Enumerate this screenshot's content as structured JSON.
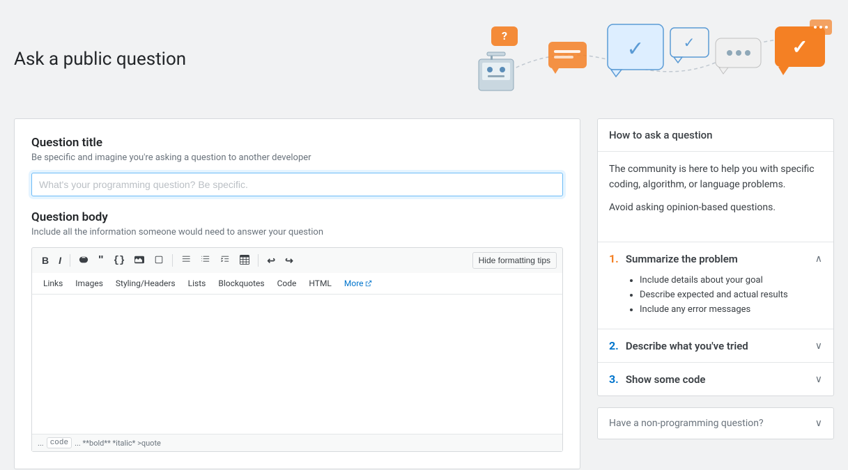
{
  "page": {
    "title": "Ask a public question"
  },
  "left": {
    "question_title_label": "Question title",
    "question_title_subtitle": "Be specific and imagine you're asking a question to another developer",
    "question_title_placeholder": "What's your programming question? Be specific.",
    "question_body_label": "Question body",
    "question_body_subtitle": "Include all the information someone would need to answer your question",
    "hide_formatting_btn": "Hide formatting tips",
    "toolbar": {
      "bold": "B",
      "italic": "I",
      "link": "🔗",
      "blockquote": "❝",
      "code": "{}",
      "image": "🖼",
      "snippet": "📄",
      "ordered_list": "ol",
      "unordered_list": "ul",
      "indent": "⇤",
      "table": "⊞",
      "undo": "↩",
      "redo": "↪"
    },
    "tabs": [
      "Links",
      "Images",
      "Styling/Headers",
      "Lists",
      "Blockquotes",
      "Code",
      "HTML"
    ],
    "more_label": "More",
    "footer_text1": "...",
    "footer_code": "code",
    "footer_text2": "... **bold** *italic* >quote"
  },
  "right": {
    "how_to_title": "How to ask a question",
    "intro_p1": "The community is here to help you with specific coding, algorithm, or language problems.",
    "intro_p2": "Avoid asking opinion-based questions.",
    "steps": [
      {
        "number": "1.",
        "label": "Summarize the problem",
        "expanded": true,
        "bullets": [
          "Include details about your goal",
          "Describe expected and actual results",
          "Include any error messages"
        ]
      },
      {
        "number": "2.",
        "label": "Describe what you've tried",
        "expanded": false,
        "bullets": []
      },
      {
        "number": "3.",
        "label": "Show some code",
        "expanded": false,
        "bullets": []
      }
    ],
    "non_programming_title": "Have a non-programming question?"
  }
}
